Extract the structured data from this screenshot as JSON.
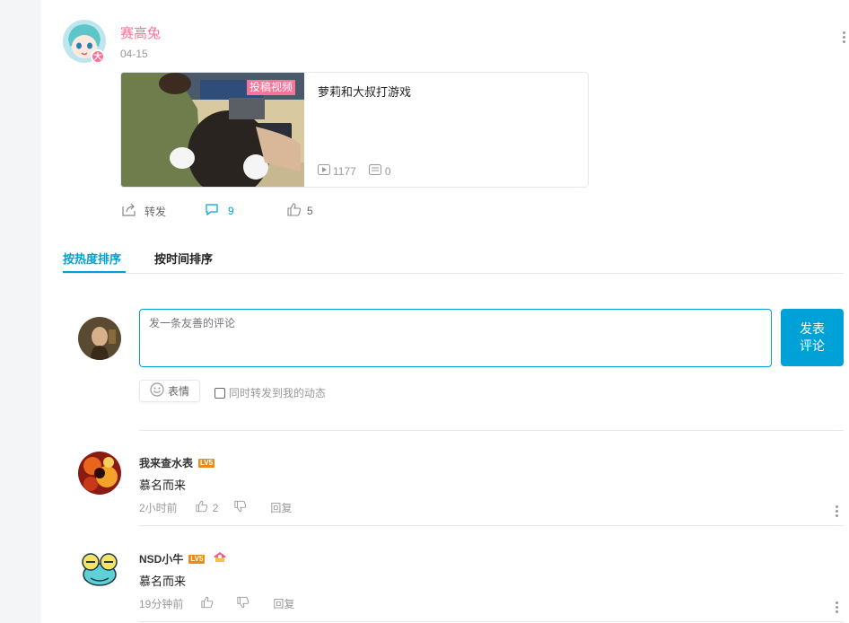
{
  "post": {
    "author": "赛高兔",
    "date": "04-15",
    "video": {
      "tag": "投稿视频",
      "title": "萝莉和大叔打游戏",
      "plays": "1177",
      "danmaku": "0"
    },
    "actions": {
      "forward_label": "转发",
      "comment_count": "9",
      "like_count": "5"
    }
  },
  "tabs": [
    {
      "label": "按热度排序",
      "active": true
    },
    {
      "label": "按时间排序",
      "active": false
    }
  ],
  "composer": {
    "placeholder": "发一条友善的评论",
    "submit_label_line1": "发表",
    "submit_label_line2": "评论",
    "emoji_label": "表情",
    "forward_checkbox_label": "同时转发到我的动态"
  },
  "comments": [
    {
      "name": "我来查水表",
      "level": "LV5",
      "text": "慕名而来",
      "time": "2小时前",
      "likes": "2",
      "reply_label": "回复"
    },
    {
      "name": "NSD小牛",
      "level": "LV5",
      "text": "慕名而来",
      "time": "19分钟前",
      "likes": "",
      "reply_label": "回复"
    }
  ],
  "colors": {
    "accent": "#00a1d6",
    "author_pink": "#fb7299",
    "level_badge": "#e98c1a"
  }
}
